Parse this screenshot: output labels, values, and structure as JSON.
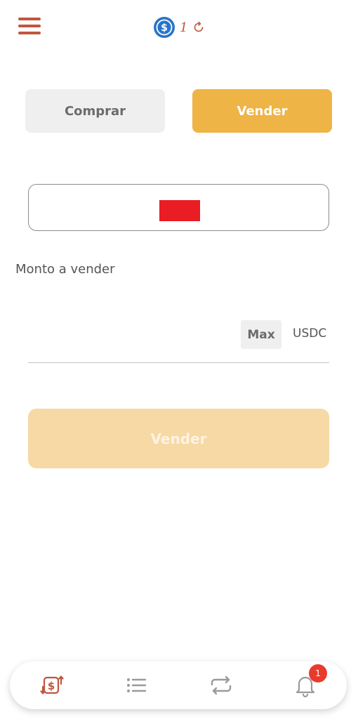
{
  "header": {
    "menu_icon": "hamburger-menu-icon",
    "coin_icon": "usdc-coin-icon",
    "balance": "1",
    "refresh_icon": "refresh-icon"
  },
  "tabs": {
    "buy_label": "Comprar",
    "sell_label": "Vender",
    "active": "sell"
  },
  "selector": {
    "flag_color": "#ea1c24"
  },
  "form": {
    "amount_label": "Monto a vender",
    "amount_value": "",
    "max_label": "Max",
    "currency": "USDC",
    "submit_label": "Vender"
  },
  "bottom_nav": {
    "items": [
      {
        "icon": "exchange-icon",
        "active": true
      },
      {
        "icon": "list-icon",
        "active": false
      },
      {
        "icon": "swap-arrows-icon",
        "active": false
      },
      {
        "icon": "bell-icon",
        "active": false
      }
    ],
    "notification_count": "1"
  },
  "colors": {
    "accent": "#eeb446",
    "brand_red": "#c0563e",
    "usdc_blue": "#2775ca",
    "badge": "#e83b2e"
  }
}
